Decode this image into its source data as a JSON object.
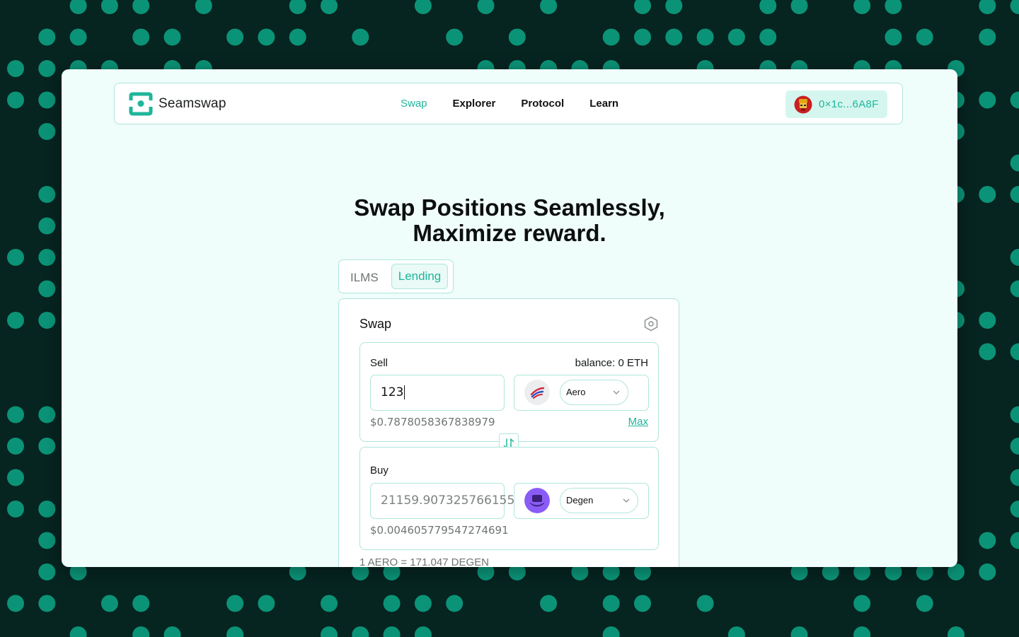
{
  "app": {
    "name": "Seamswap",
    "brand_color": "#1fb59a",
    "background_color": "#062420",
    "dot_color": "#0b9377"
  },
  "nav": {
    "items": [
      {
        "label": "Swap",
        "active": true
      },
      {
        "label": "Explorer",
        "active": false
      },
      {
        "label": "Protocol",
        "active": false
      },
      {
        "label": "Learn",
        "active": false
      }
    ]
  },
  "wallet": {
    "address": "0×1c...6A8F",
    "avatar_icon": "avatar-icon"
  },
  "hero": {
    "line1": "Swap Positions Seamlessly,",
    "line2": "Maximize reward."
  },
  "tabs": {
    "ilms": "ILMS",
    "lending": "Lending",
    "selected": "Lending"
  },
  "swap": {
    "title": "Swap",
    "settings_icon": "settings-icon",
    "sell": {
      "label": "Sell",
      "balance": "balance: 0 ETH",
      "amount": "123",
      "token": "Aero",
      "usd_value": "$0.7878058367838979",
      "max_label": "Max"
    },
    "flip_icon": "swap-direction-icon",
    "buy": {
      "label": "Buy",
      "amount": "21159.907325766155",
      "token": "Degen",
      "usd_value": "$0.004605779547274691"
    },
    "rate": "1 AERO = 171.047 DEGEN"
  }
}
